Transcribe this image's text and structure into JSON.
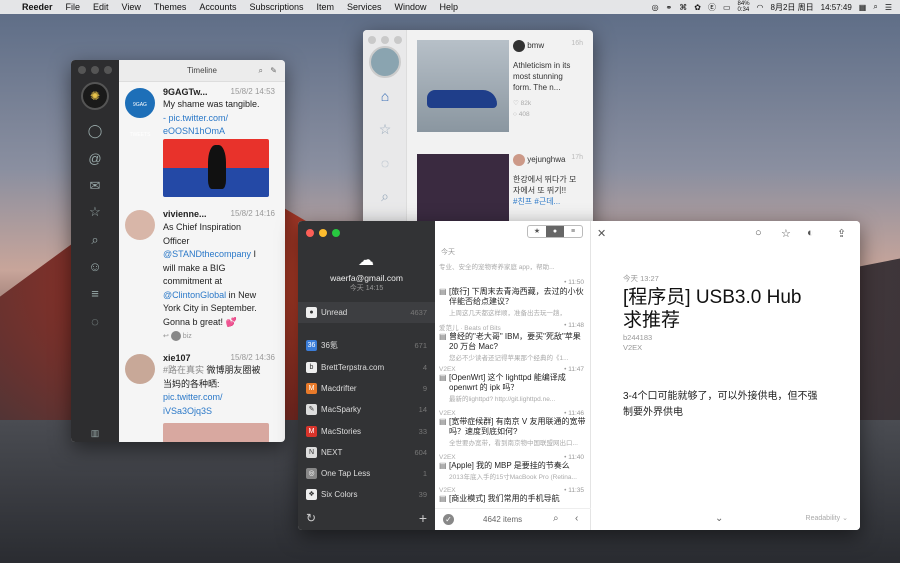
{
  "menubar": {
    "apple": "",
    "app": "Reeder",
    "items": [
      "File",
      "Edit",
      "View",
      "Themes",
      "Accounts",
      "Subscriptions",
      "Item",
      "Services",
      "Window",
      "Help"
    ],
    "battery": "84%\n0:34",
    "date": "8月2日 周日",
    "time": "14:57:49"
  },
  "tweetbot": {
    "title": "Timeline",
    "tweets": [
      {
        "name": "9GAGTw...",
        "time": "15/8/2 14:53",
        "text": "My shame was tangible.",
        "link1": "- pic.twitter.com/",
        "link2": "eOOSN1hOmA",
        "avatar_text": "9GAG TWEETS"
      },
      {
        "name": "vivienne...",
        "time": "15/8/2 14:16",
        "l1": "As Chief Inspiration",
        "l2": "Officer",
        "l3": "@STANDthecompany",
        "l3b": " I",
        "l4": "will make a BIG",
        "l5": "commitment at",
        "l6": "@ClintonGlobal",
        "l6b": " in New",
        "l7": "York City in September.",
        "l8": "Gonna b great! 💕",
        "reply_user": "biz"
      },
      {
        "name": "xie107",
        "time": "15/8/2 14:36",
        "l1": "#路在真实",
        "l1b": " 微博朋友圈被",
        "l2": "当妈的各种晒:",
        "l3": "pic.twitter.com/",
        "l4": "iVSa3Ojq3S"
      }
    ]
  },
  "insta": {
    "posts": [
      {
        "user": "bmw",
        "age": "16h",
        "lines": [
          "Athleticism in its",
          "most stunning",
          "form. The n..."
        ],
        "likes": "82k",
        "comments": "408"
      },
      {
        "user": "yejunghwa",
        "age": "17h",
        "lines": [
          "한강에서 뛰다가 모",
          "자에서 또 뛰기!!",
          "#친프 #근데..."
        ]
      }
    ]
  },
  "reeder": {
    "account": "waerfa@gmail.com",
    "updated": "今天 14:15",
    "unread_label": "Unread",
    "unread_count": "4637",
    "feeds": [
      {
        "name": "36氪",
        "count": "671",
        "color": "#3b7dd8",
        "glyph": "36"
      },
      {
        "name": "BrettTerpstra.com",
        "count": "4",
        "color": "#eee",
        "glyph": "b"
      },
      {
        "name": "Macdrifter",
        "count": "9",
        "color": "#e87a2a",
        "glyph": "M"
      },
      {
        "name": "MacSparky",
        "count": "14",
        "color": "#ddd",
        "glyph": "✎"
      },
      {
        "name": "MacStories",
        "count": "33",
        "color": "#d9342b",
        "glyph": "M"
      },
      {
        "name": "NEXT",
        "count": "604",
        "color": "#ddd",
        "glyph": "N"
      },
      {
        "name": "One Tap Less",
        "count": "1",
        "color": "#888",
        "glyph": "◎"
      },
      {
        "name": "Six Colors",
        "count": "39",
        "color": "#eee",
        "glyph": "❖"
      }
    ],
    "list_header": "今天",
    "top_excerpt": "专业、安全的宠物寄养家庭 app，帮助...",
    "items": [
      {
        "src": "",
        "time": "• 11:50",
        "title": "[旅行] 下周末去青海西藏，去过的小伙伴能否给点建议？",
        "ex": "上周这几天都这样顺，准备出去玩一趟，"
      },
      {
        "src": "爱范儿 · Beats of Bits",
        "time": "• 11:48",
        "title": "曾经的\"老大哥\" IBM，要买\"死敌\"苹果 20 万台 Mac?",
        "ex": "您必不少读者还记得苹果那个经典的《1..."
      },
      {
        "src": "V2EX",
        "time": "• 11:47",
        "title": "[OpenWrt] 这个 lighttpd 能编译成 openwrt 的 ipk 吗？",
        "ex": "最新的lighttpd? http://git.lighttpd.ne..."
      },
      {
        "src": "V2EX",
        "time": "• 11:46",
        "title": "[宽带症候群] 有南京 V 友用联通的宽带吗？速度到底如何?",
        "ex": "全世要办宽带，看到南京物中国联盟网出口..."
      },
      {
        "src": "V2EX",
        "time": "• 11:40",
        "title": "[Apple] 我的 MBP 是要挂的节奏么",
        "ex": "2013年底入手的15寸MacBook Pro (Retina..."
      },
      {
        "src": "V2EX",
        "time": "• 11:35",
        "title": "[商业模式] 我们常用的手机导航"
      }
    ],
    "items_count": "4642 items",
    "article": {
      "date": "今天 13:27",
      "title_l1": "[程序员] USB3.0 Hub",
      "title_l2": "求推荐",
      "author": "b244183",
      "source": "V2EX",
      "body_l1": "3-4个口可能就够了，可以外接供电，但不强",
      "body_l2": "制要外界供电",
      "readability": "Readability ⌄"
    }
  }
}
